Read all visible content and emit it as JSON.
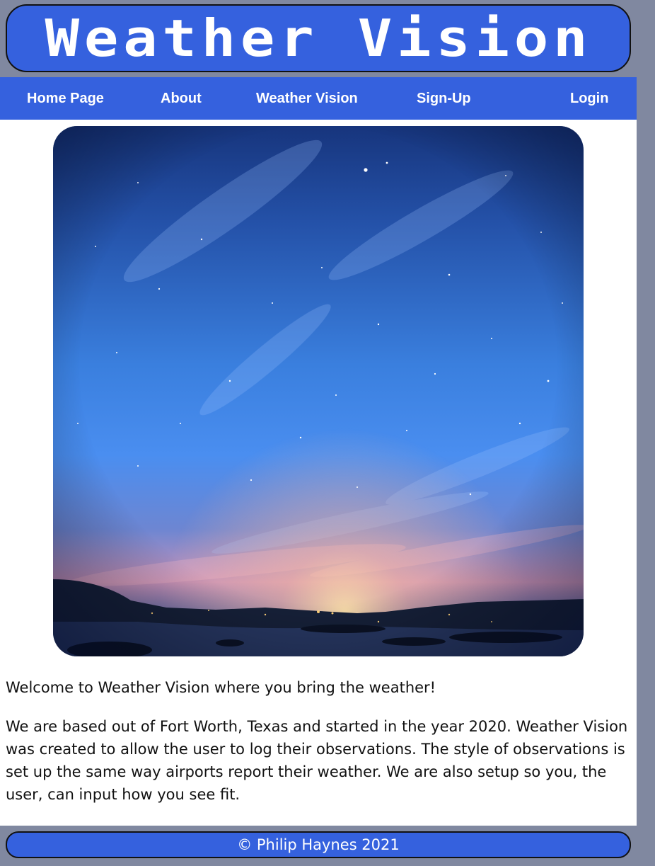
{
  "header": {
    "title": "Weather Vision"
  },
  "nav": {
    "items": [
      {
        "label": "Home Page"
      },
      {
        "label": "About"
      },
      {
        "label": "Weather Vision"
      },
      {
        "label": "Sign-Up"
      },
      {
        "label": "Login"
      }
    ]
  },
  "main": {
    "welcome": "Welcome to Weather Vision where you bring the weather!",
    "about": "We are based out of Fort Worth, Texas and started in the year 2020. Weather Vision was created to allow the user to log their observations. The style of observations is set up the same way airports report their weather. We are also setup so you, the user, can input how you see fit."
  },
  "footer": {
    "copyright": "© Philip Haynes 2021"
  },
  "colors": {
    "brand_blue": "#3561de",
    "page_background": "#8088a0",
    "content_background": "#ffffff"
  }
}
